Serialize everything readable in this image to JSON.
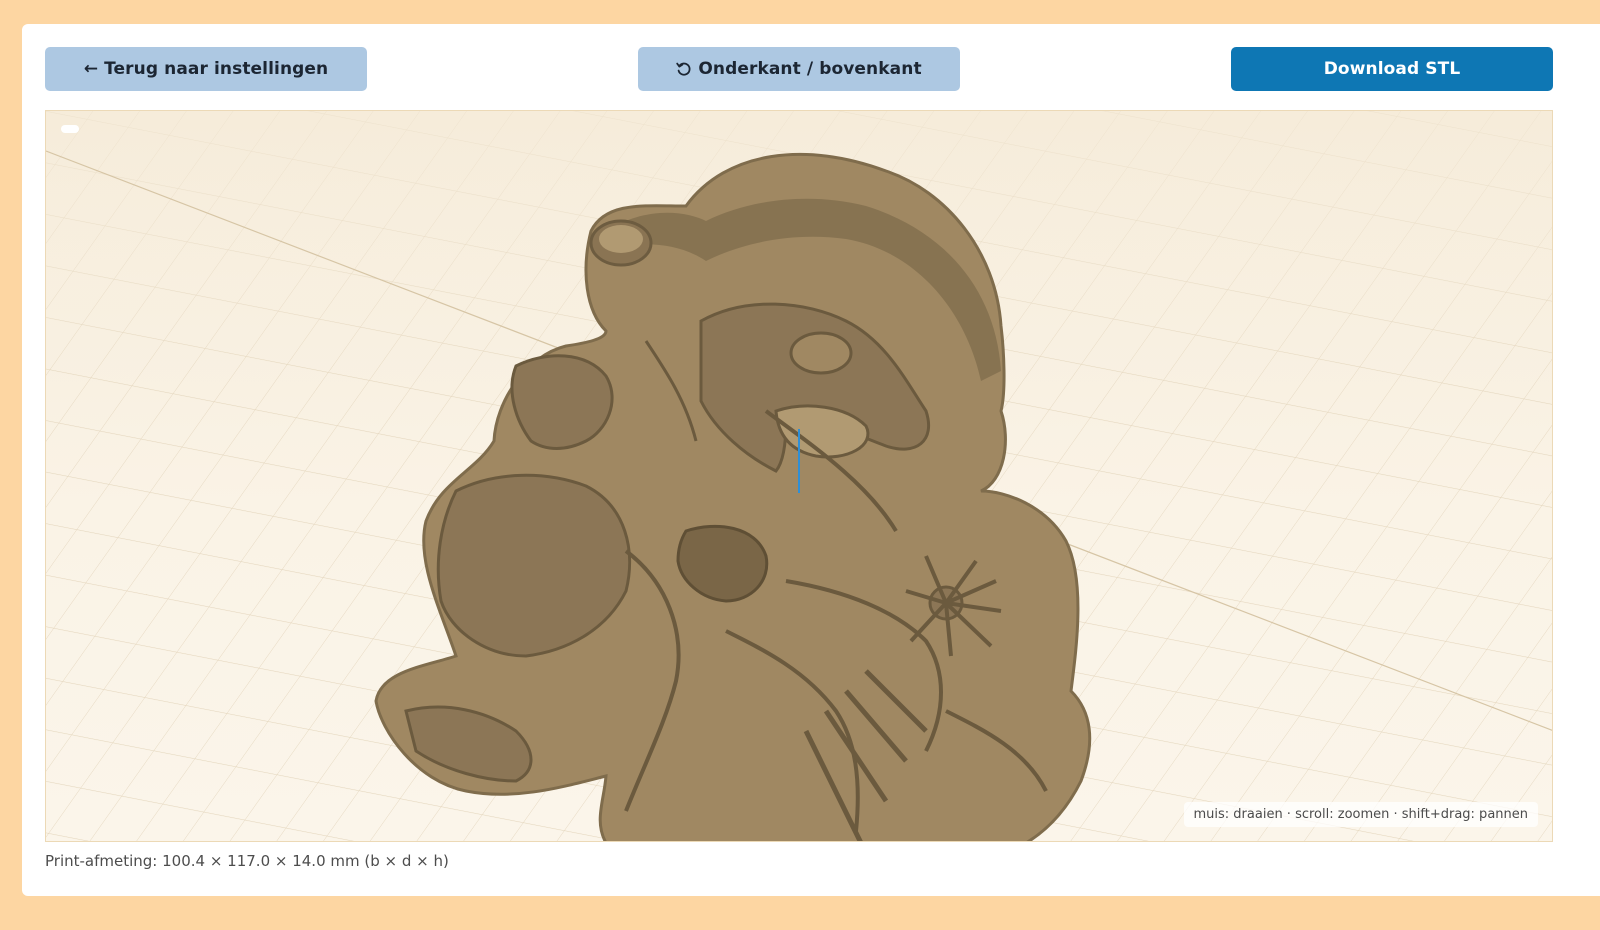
{
  "toolbar": {
    "back_label": "← Terug naar instellingen",
    "flip_icon": "rotate-ccw-icon",
    "flip_label": "Onderkant / bovenkant",
    "download_label": "Download STL"
  },
  "viewer": {
    "hint": "muis: draaien · scroll: zoomen · shift+drag: pannen"
  },
  "footer": {
    "print_size": "Print-afmeting: 100.4 × 117.0 × 14.0 mm (b × d × h)"
  },
  "colors": {
    "page_background": "#fdd6a2",
    "button_light": "#adc8e2",
    "button_primary": "#0e77b4",
    "model_face": "#a08862",
    "model_wall": "#7f6c4c"
  }
}
